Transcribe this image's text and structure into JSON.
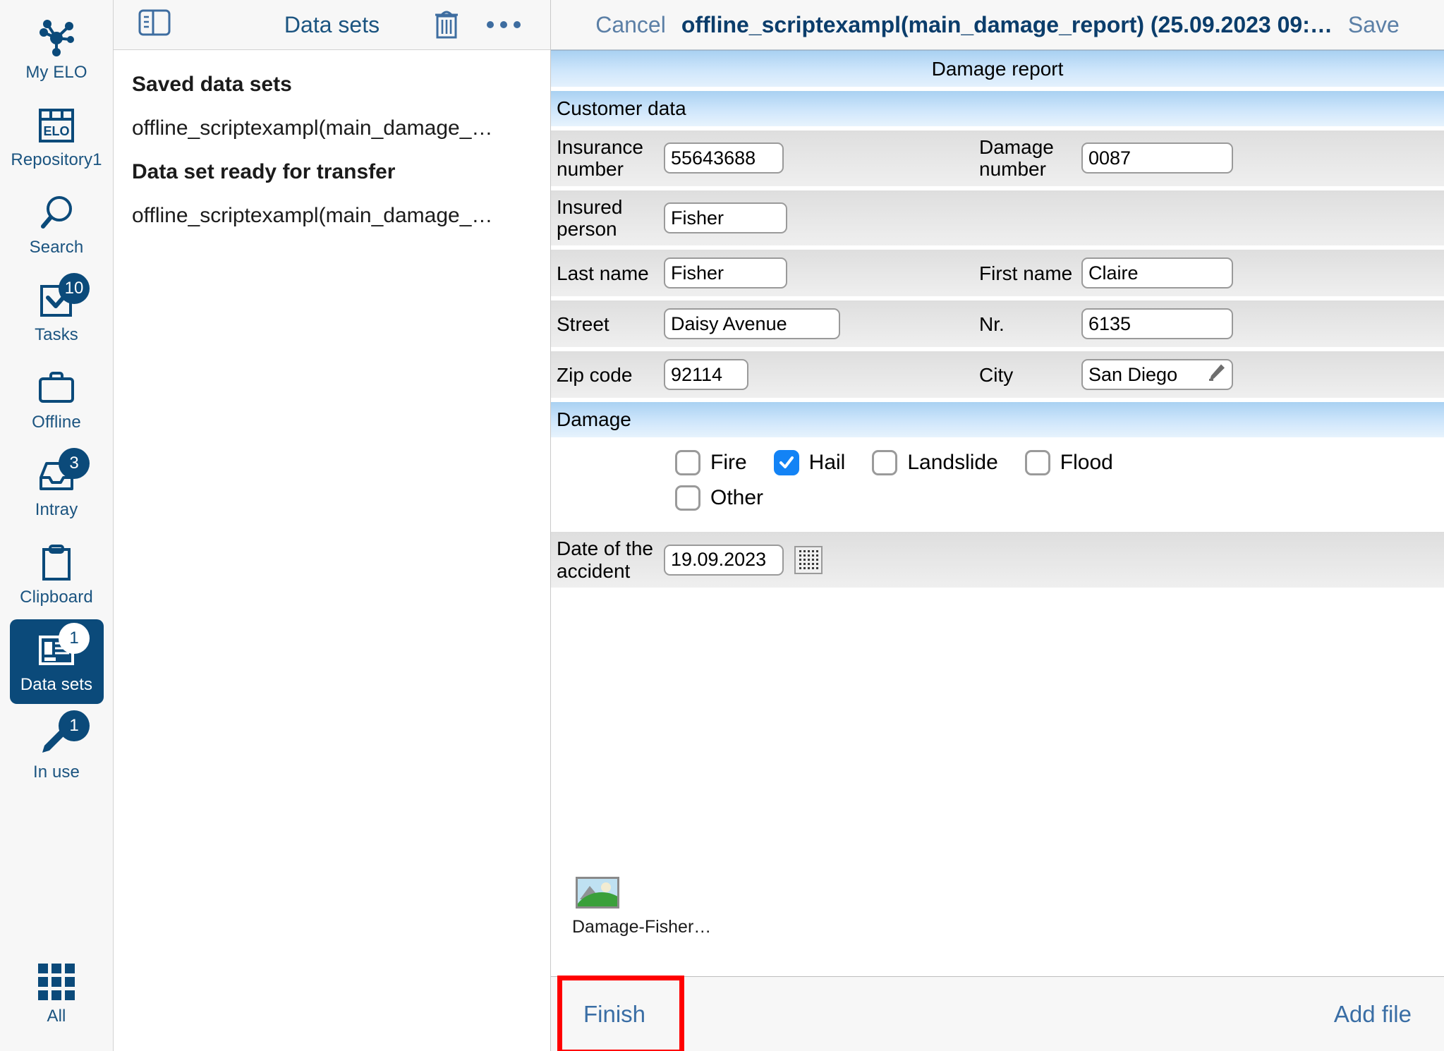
{
  "rail": {
    "items": [
      {
        "label": "My ELO",
        "icon": "network-nodes-icon",
        "badge": null,
        "selected": false
      },
      {
        "label": "Repository1",
        "icon": "elo-repository-icon",
        "badge": null,
        "selected": false
      },
      {
        "label": "Search",
        "icon": "search-icon",
        "badge": null,
        "selected": false
      },
      {
        "label": "Tasks",
        "icon": "tasks-checkbox-icon",
        "badge": "10",
        "selected": false
      },
      {
        "label": "Offline",
        "icon": "briefcase-icon",
        "badge": null,
        "selected": false
      },
      {
        "label": "Intray",
        "icon": "intray-tray-icon",
        "badge": "3",
        "selected": false
      },
      {
        "label": "Clipboard",
        "icon": "clipboard-icon",
        "badge": null,
        "selected": false
      },
      {
        "label": "Data sets",
        "icon": "data-sets-icon",
        "badge": "1",
        "selected": true
      },
      {
        "label": "In use",
        "icon": "pen-in-use-icon",
        "badge": "1",
        "selected": false
      }
    ],
    "bottom": {
      "label": "All",
      "icon": "grid-all-icon"
    }
  },
  "list_panel": {
    "header": {
      "title": "Data sets",
      "panel_toggle_icon": "panel-toggle-icon",
      "delete_icon": "trash-icon",
      "more_icon": "more-ellipsis-icon"
    },
    "groups": [
      {
        "title": "Saved data sets",
        "items": [
          "offline_scriptexampl(main_damage_…"
        ]
      },
      {
        "title": "Data set ready for transfer",
        "items": [
          "offline_scriptexampl(main_damage_…"
        ]
      }
    ]
  },
  "detail": {
    "header": {
      "cancel_label": "Cancel",
      "doc_title": "offline_scriptexampl(main_damage_report) (25.09.2023 09:…",
      "save_label": "Save"
    },
    "form_title": "Damage report",
    "sections": [
      {
        "name": "customer_data",
        "title": "Customer data"
      },
      {
        "name": "damage",
        "title": "Damage"
      }
    ],
    "fields": {
      "insurance_number": {
        "label": "Insurance number",
        "value": "55643688"
      },
      "damage_number": {
        "label": "Damage number",
        "value": "0087"
      },
      "insured_person": {
        "label": "Insured person",
        "value": "Fisher"
      },
      "last_name": {
        "label": "Last name",
        "value": "Fisher"
      },
      "first_name": {
        "label": "First name",
        "value": "Claire"
      },
      "street": {
        "label": "Street",
        "value": "Daisy Avenue"
      },
      "nr": {
        "label": "Nr.",
        "value": "6135"
      },
      "zip_code": {
        "label": "Zip code",
        "value": "92114"
      },
      "city": {
        "label": "City",
        "value": "San Diego",
        "edit_icon": "pencil-edit-icon"
      },
      "accident_date": {
        "label": "Date of the accident",
        "value": "19.09.2023",
        "picker_icon": "calendar-icon"
      }
    },
    "damage_types": [
      {
        "label": "Fire",
        "checked": false
      },
      {
        "label": "Hail",
        "checked": true
      },
      {
        "label": "Landslide",
        "checked": false
      },
      {
        "label": "Flood",
        "checked": false
      },
      {
        "label": "Other",
        "checked": false
      }
    ],
    "attachment": {
      "name": "Damage-Fisher…",
      "thumb_icon": "image-thumbnail-icon"
    },
    "footer": {
      "finish_label": "Finish",
      "add_file_label": "Add file"
    }
  },
  "colors": {
    "brand_blue": "#0b4a7a",
    "link_blue": "#3a6ea5",
    "checkbox_active": "#1383f5",
    "annotation_red": "#ff0000",
    "section_blue": "#a9d1f2"
  }
}
